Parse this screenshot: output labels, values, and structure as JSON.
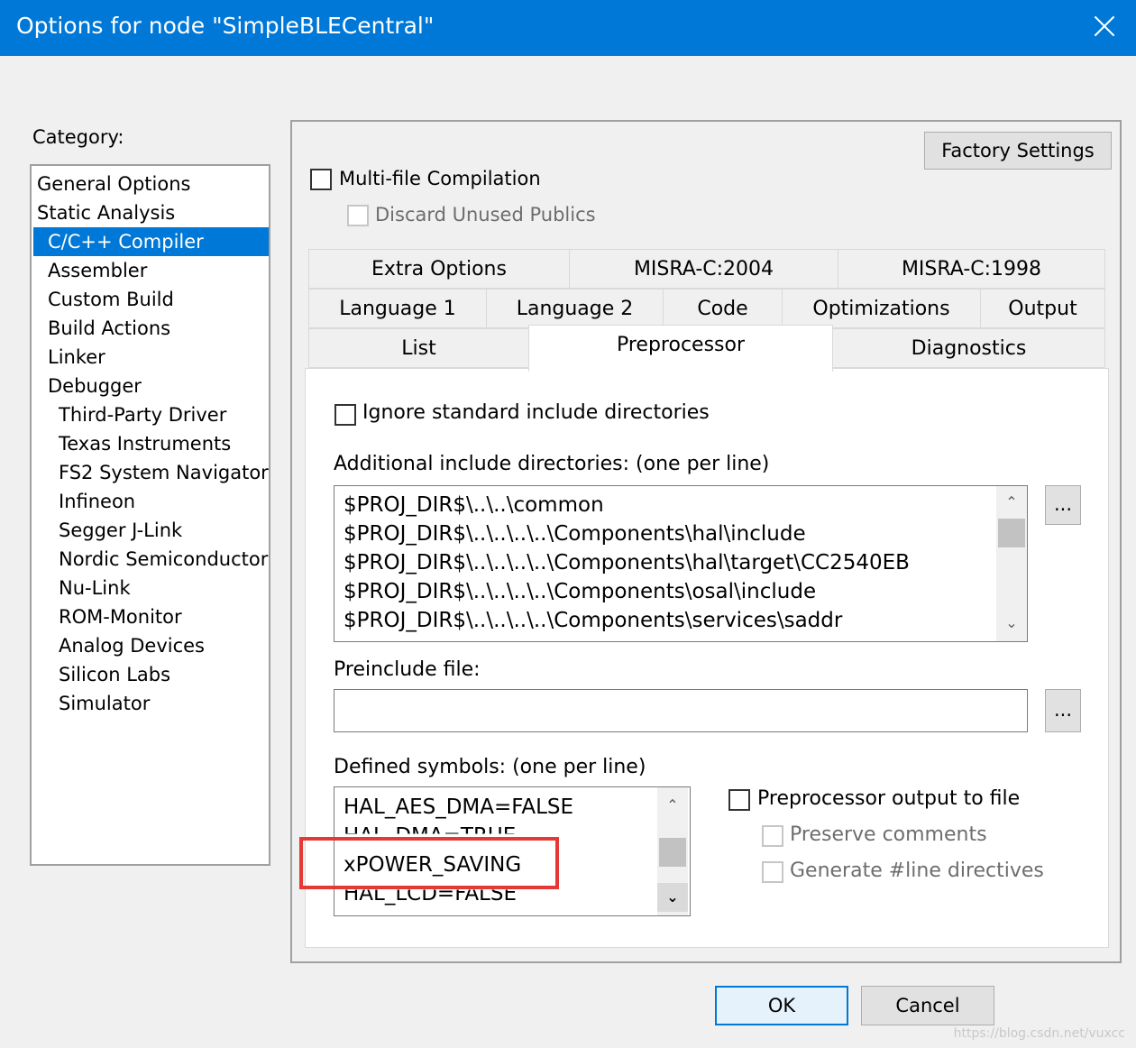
{
  "window": {
    "title": "Options for node \"SimpleBLECentral\""
  },
  "category": {
    "label": "Category:",
    "items": [
      {
        "label": "General Options"
      },
      {
        "label": "Static Analysis"
      },
      {
        "label": "C/C++ Compiler"
      },
      {
        "label": "Assembler"
      },
      {
        "label": "Custom Build"
      },
      {
        "label": "Build Actions"
      },
      {
        "label": "Linker"
      },
      {
        "label": "Debugger"
      },
      {
        "label": "Third-Party Driver"
      },
      {
        "label": "Texas Instruments"
      },
      {
        "label": "FS2 System Navigator"
      },
      {
        "label": "Infineon"
      },
      {
        "label": "Segger J-Link"
      },
      {
        "label": "Nordic Semiconductor"
      },
      {
        "label": "Nu-Link"
      },
      {
        "label": "ROM-Monitor"
      },
      {
        "label": "Analog Devices"
      },
      {
        "label": "Silicon Labs"
      },
      {
        "label": "Simulator"
      }
    ],
    "selected": "C/C++ Compiler"
  },
  "panel": {
    "factory_settings": "Factory Settings",
    "multi_file": "Multi-file Compilation",
    "discard_unused": "Discard Unused Publics",
    "tabs_row1": [
      "Extra Options",
      "MISRA-C:2004",
      "MISRA-C:1998"
    ],
    "tabs_row2": [
      "Language 1",
      "Language 2",
      "Code",
      "Optimizations",
      "Output"
    ],
    "tabs_row3": [
      "List",
      "Preprocessor",
      "Diagnostics"
    ],
    "active_tab": "Preprocessor"
  },
  "preprocessor": {
    "ignore_std": "Ignore standard include directories",
    "include_label": "Additional include directories: (one per line)",
    "include_dirs": [
      "$PROJ_DIR$\\..\\..\\common",
      "$PROJ_DIR$\\..\\..\\..\\..\\Components\\hal\\include",
      "$PROJ_DIR$\\..\\..\\..\\..\\Components\\hal\\target\\CC2540EB",
      "$PROJ_DIR$\\..\\..\\..\\..\\Components\\osal\\include",
      "$PROJ_DIR$\\..\\..\\..\\..\\Components\\services\\saddr"
    ],
    "browse": "...",
    "preinclude_label": "Preinclude file:",
    "preinclude_value": "",
    "defined_label": "Defined symbols: (one per line)",
    "defined_symbols": [
      "HAL_AES_DMA=FALSE",
      "HAL_DMA=TRUE",
      "xPOWER_SAVING",
      "HAL_LCD=FALSE"
    ],
    "pp_output": "Preprocessor output to file",
    "preserve_comments": "Preserve comments",
    "generate_line": "Generate #line directives"
  },
  "footer": {
    "ok": "OK",
    "cancel": "Cancel"
  },
  "watermark": "https://blog.csdn.net/vuxcc"
}
